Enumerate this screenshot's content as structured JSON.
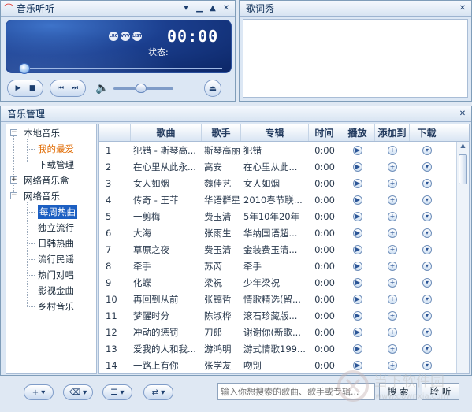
{
  "player": {
    "title": "音乐听听",
    "screen_buttons": [
      "LRC",
      "VVV",
      "LIST"
    ],
    "time": "00:00",
    "status_label": "状态:",
    "volume": 0.45
  },
  "lyrics": {
    "title": "歌词秀"
  },
  "manager": {
    "title": "音乐管理",
    "tree": [
      {
        "label": "本地音乐",
        "level": 0,
        "expanded": true
      },
      {
        "label": "我的最爱",
        "level": 1,
        "highlight": "orange"
      },
      {
        "label": "下载管理",
        "level": 1
      },
      {
        "label": "网络音乐盒",
        "level": 0,
        "expanded": false
      },
      {
        "label": "网络音乐",
        "level": 0,
        "expanded": true
      },
      {
        "label": "每周热曲",
        "level": 1,
        "selected": true
      },
      {
        "label": "独立流行",
        "level": 1
      },
      {
        "label": "日韩热曲",
        "level": 1
      },
      {
        "label": "流行民谣",
        "level": 1
      },
      {
        "label": "热门对唱",
        "level": 1
      },
      {
        "label": "影视金曲",
        "level": 1
      },
      {
        "label": "乡村音乐",
        "level": 1
      }
    ],
    "columns": [
      "",
      "歌曲",
      "歌手",
      "专辑",
      "时间",
      "播放",
      "添加到",
      "下载"
    ],
    "rows": [
      {
        "no": "1",
        "song": "犯错 - 斯琴高...",
        "singer": "斯琴高丽",
        "album": "犯错",
        "time": "0:00"
      },
      {
        "no": "2",
        "song": "在心里从此永...",
        "singer": "高安",
        "album": "在心里从此...",
        "time": "0:00"
      },
      {
        "no": "3",
        "song": "女人如烟",
        "singer": "魏佳艺",
        "album": "女人如烟",
        "time": "0:00"
      },
      {
        "no": "4",
        "song": "传奇 - 王菲",
        "singer": "华语群星",
        "album": "2010春节联...",
        "time": "0:00"
      },
      {
        "no": "5",
        "song": "一剪梅",
        "singer": "费玉清",
        "album": "5年10年20年",
        "time": "0:00"
      },
      {
        "no": "6",
        "song": "大海",
        "singer": "张雨生",
        "album": "华纳国语超...",
        "time": "0:00"
      },
      {
        "no": "7",
        "song": "草原之夜",
        "singer": "费玉清",
        "album": "金装费玉清...",
        "time": "0:00"
      },
      {
        "no": "8",
        "song": "牵手",
        "singer": "苏芮",
        "album": "牵手",
        "time": "0:00"
      },
      {
        "no": "9",
        "song": "化蝶",
        "singer": "梁祝",
        "album": "少年梁祝",
        "time": "0:00"
      },
      {
        "no": "10",
        "song": "再回到从前",
        "singer": "张镐哲",
        "album": "情歌精选(留...",
        "time": "0:00"
      },
      {
        "no": "11",
        "song": "梦醒时分",
        "singer": "陈淑桦",
        "album": "滚石珍藏版...",
        "time": "0:00"
      },
      {
        "no": "12",
        "song": "冲动的惩罚",
        "singer": "刀郎",
        "album": "谢谢你(新歌...",
        "time": "0:00"
      },
      {
        "no": "13",
        "song": "爱我的人和我...",
        "singer": "游鸿明",
        "album": "游式情歌199...",
        "time": "0:00"
      },
      {
        "no": "14",
        "song": "一路上有你",
        "singer": "张学友",
        "album": "吻别",
        "time": "0:00"
      }
    ]
  },
  "bottom": {
    "search_placeholder": "输入你想搜索的歌曲、歌手或专辑...",
    "search_label": "搜 索",
    "listen_label": "聆 听"
  },
  "watermark": {
    "text": "当下软件园",
    "url": "www.downxia.com"
  }
}
